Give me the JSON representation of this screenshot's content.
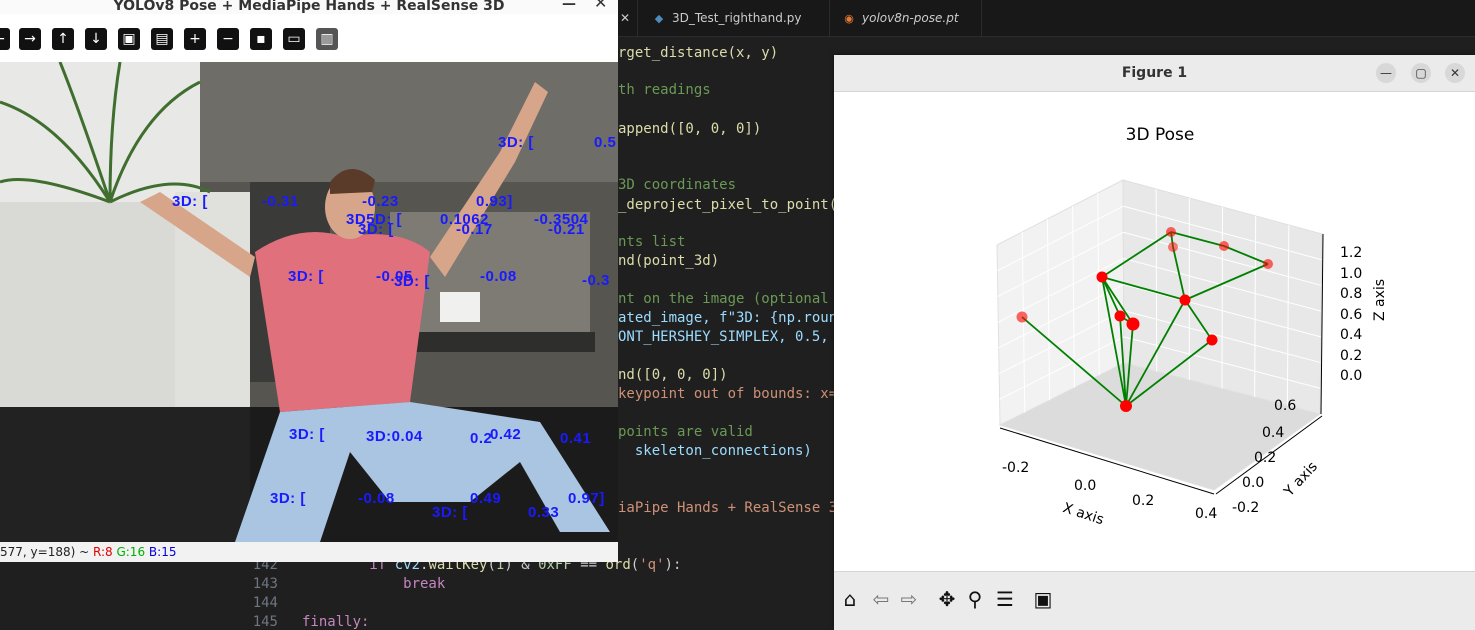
{
  "editor": {
    "tabs": [
      {
        "label": "",
        "icon": "close-icon"
      },
      {
        "label": "3D_Test_righthand.py",
        "icon": "python-file-icon"
      },
      {
        "label": "yolov8n-pose.pt",
        "icon": "rss-file-icon"
      }
    ],
    "code_lines": [
      {
        "num": "",
        "text": "rget_distance(x, y)"
      },
      {
        "num": "",
        "text": "th readings"
      },
      {
        "num": "",
        "text": "append([0, 0, 0])"
      },
      {
        "num": "",
        "text": "3D coordinates"
      },
      {
        "num": "",
        "text": "_deproject_pixel_to_point("
      },
      {
        "num": "",
        "text": "nts list"
      },
      {
        "num": "",
        "text": "nd(point_3d)"
      },
      {
        "num": "",
        "text": "nt on the image (optional"
      },
      {
        "num": "",
        "text": "ated_image, f\"3D: {np.roun"
      },
      {
        "num": "",
        "text": "ONT_HERSHEY_SIMPLEX, 0.5,"
      },
      {
        "num": "",
        "text": "nd([0, 0, 0])"
      },
      {
        "num": "",
        "text": "keypoint out of bounds: x="
      },
      {
        "num": "",
        "text": "points are valid"
      },
      {
        "num": "",
        "text": "  skeleton_connections)"
      },
      {
        "num": "",
        "text": "iaPipe Hands + RealSense 3"
      },
      {
        "num": "142",
        "text": "        if cv2.waitKey(1) & 0xFF == ord('q'):"
      },
      {
        "num": "143",
        "text": "            break"
      },
      {
        "num": "144",
        "text": ""
      },
      {
        "num": "145",
        "text": "finally:"
      }
    ]
  },
  "cv_window": {
    "title": "YOLOv8 Pose + MediaPipe Hands + RealSense 3D",
    "toolbar_icons": [
      "arrow-left-icon",
      "arrow-right-icon",
      "arrow-up-icon",
      "arrow-down-icon",
      "image-icon",
      "image-settings-icon",
      "zoom-in-icon",
      "zoom-out-icon",
      "save-icon",
      "clipboard-icon",
      "properties-icon"
    ],
    "labels": [
      {
        "text": "3D: [",
        "id": "a"
      },
      {
        "text": "0.5",
        "id": "b"
      },
      {
        "text": "3D: [",
        "id": "c"
      },
      {
        "text": "-0.31",
        "id": "d"
      },
      {
        "text": "-0.23",
        "id": "e"
      },
      {
        "text": "0.93]",
        "id": "f"
      },
      {
        "text": "3D5D: [",
        "id": "g"
      },
      {
        "text": "0.1062",
        "id": "h"
      },
      {
        "text": "-0.3504",
        "id": "i"
      },
      {
        "text": "3D: [",
        "id": "j"
      },
      {
        "text": "-0.17",
        "id": "k"
      },
      {
        "text": "-0.21",
        "id": "l"
      },
      {
        "text": "3D: [",
        "id": "m"
      },
      {
        "text": "-0.05",
        "id": "n"
      },
      {
        "text": "3D: [",
        "id": "o"
      },
      {
        "text": "-0.08",
        "id": "p"
      },
      {
        "text": "-0.3",
        "id": "q"
      },
      {
        "text": "3D: [",
        "id": "r"
      },
      {
        "text": "3D:0.04",
        "id": "s"
      },
      {
        "text": "0.42",
        "id": "t"
      },
      {
        "text": "0.2",
        "id": "u"
      },
      {
        "text": "0.41",
        "id": "v"
      },
      {
        "text": "3D: [",
        "id": "w"
      },
      {
        "text": "-0.08",
        "id": "x"
      },
      {
        "text": "0.49",
        "id": "y"
      },
      {
        "text": "0.97]",
        "id": "z"
      },
      {
        "text": "3D: [",
        "id": "aa"
      },
      {
        "text": "0.33",
        "id": "ab"
      }
    ],
    "status": {
      "coords": "577, y=188) ~",
      "r": "R:8",
      "g": "G:16",
      "b": "B:15"
    }
  },
  "figure": {
    "window_title": "Figure 1",
    "toolbar_icons": [
      "home-icon",
      "back-icon",
      "forward-icon",
      "pan-icon",
      "zoom-icon",
      "configure-icon",
      "save-icon"
    ]
  },
  "chart_data": {
    "type": "scatter",
    "title": "3D Pose",
    "xlabel": "X axis",
    "ylabel": "Y axis",
    "zlabel": "Z axis",
    "x_ticks": [
      "-0.2",
      "0.0",
      "0.2",
      "0.4"
    ],
    "y_ticks": [
      "-0.2",
      "0.0",
      "0.2",
      "0.4",
      "0.6"
    ],
    "z_ticks": [
      "0.0",
      "0.2",
      "0.4",
      "0.6",
      "0.8",
      "1.0",
      "1.2"
    ],
    "point_color": "#ff0000",
    "line_color": "#008000"
  }
}
